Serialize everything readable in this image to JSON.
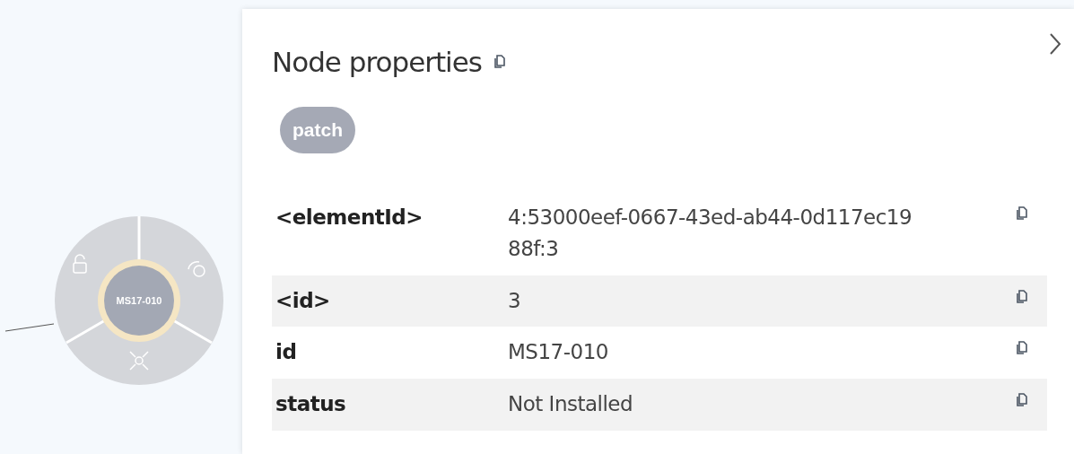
{
  "graph": {
    "node": {
      "label": "MS17-010"
    }
  },
  "panel": {
    "title": "Node properties",
    "labels": [
      "patch"
    ],
    "properties": [
      {
        "key": "<elementId>",
        "value": "4:53000eef-0667-43ed-ab44-0d117ec1988f:3"
      },
      {
        "key": "<id>",
        "value": "3"
      },
      {
        "key": "id",
        "value": "MS17-010"
      },
      {
        "key": "status",
        "value": "Not Installed"
      }
    ]
  }
}
